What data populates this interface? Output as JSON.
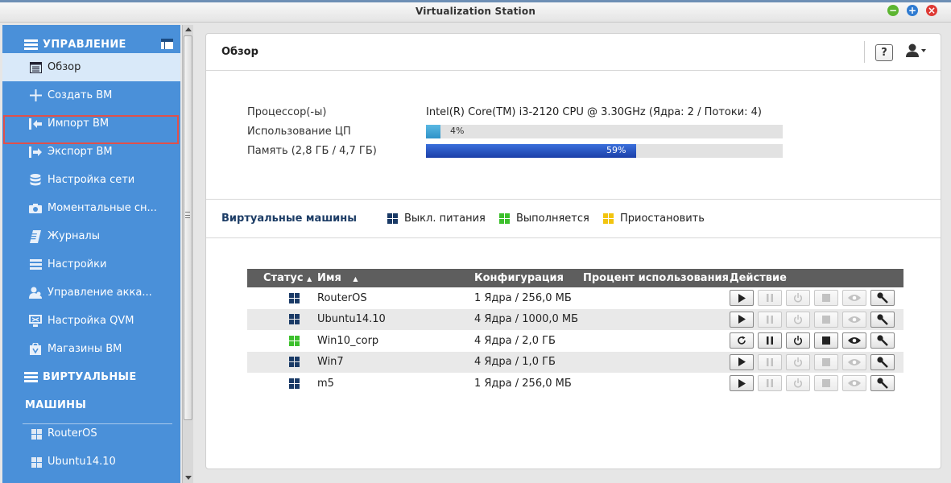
{
  "window": {
    "title": "Virtualization Station"
  },
  "sidebar": {
    "section1": "УПРАВЛЕНИЕ",
    "items": [
      {
        "label": "Обзор",
        "icon": "overview-icon",
        "active": true
      },
      {
        "label": "Создать ВМ",
        "icon": "plus-icon"
      },
      {
        "label": "Импорт ВМ",
        "icon": "import-icon"
      },
      {
        "label": "Экспорт ВМ",
        "icon": "export-icon"
      },
      {
        "label": "Настройка сети",
        "icon": "database-icon"
      },
      {
        "label": "Моментальные сн...",
        "icon": "camera-icon"
      },
      {
        "label": "Журналы",
        "icon": "log-icon"
      },
      {
        "label": "Настройки",
        "icon": "settings-icon"
      },
      {
        "label": "Управление акка...",
        "icon": "users-icon"
      },
      {
        "label": "Настройка QVM",
        "icon": "monitor-icon"
      },
      {
        "label": "Магазины ВМ",
        "icon": "store-icon"
      }
    ],
    "section2_line1": "ВИРТУАЛЬНЫЕ",
    "section2_line2": "МАШИНЫ",
    "vms": [
      {
        "label": "RouterOS"
      },
      {
        "label": "Ubuntu14.10"
      }
    ]
  },
  "main": {
    "title": "Обзор",
    "help": "?",
    "cpu_label": "Процессор(-ы)",
    "cpu_value": "Intel(R) Core(TM) i3-2120 CPU @ 3.30GHz (Ядра: 2 / Потоки: 4)",
    "cpu_usage_label": "Использование ЦП",
    "cpu_usage_text": "4%",
    "cpu_usage_value": 4,
    "memory_label": "Память (2,8 ГБ / 4,7 ГБ)",
    "memory_text": "59%",
    "memory_value": 59,
    "vm_section_title": "Виртуальные машины",
    "legend": [
      {
        "label": "Выкл. питания",
        "color": "#1a3a66"
      },
      {
        "label": "Выполняется",
        "color": "#3cc02c"
      },
      {
        "label": "Приостановить",
        "color": "#f2c40f"
      }
    ]
  },
  "table": {
    "headers": {
      "status": "Статус",
      "name": "Имя",
      "config": "Конфигурация",
      "usage": "Процент использования",
      "action": "Действие"
    },
    "rows": [
      {
        "name": "RouterOS",
        "config": "1 Ядра / 256,0 МБ",
        "state": "off"
      },
      {
        "name": "Ubuntu14.10",
        "config": "4 Ядра / 1000,0 МБ",
        "state": "off"
      },
      {
        "name": "Win10_corp",
        "config": "4 Ядра / 2,0 ГБ",
        "state": "running"
      },
      {
        "name": "Win7",
        "config": "4 Ядра / 1,0 ГБ",
        "state": "off"
      },
      {
        "name": "m5",
        "config": "1 Ядра / 256,0 МБ",
        "state": "off"
      }
    ]
  },
  "colors": {
    "sidebar": "#4a90d9",
    "off": "#1a3a66",
    "running": "#3cc02c",
    "paused": "#f2c40f",
    "cpu_bar": "#3aa3d6",
    "mem_bar": "#1f4fc0"
  }
}
